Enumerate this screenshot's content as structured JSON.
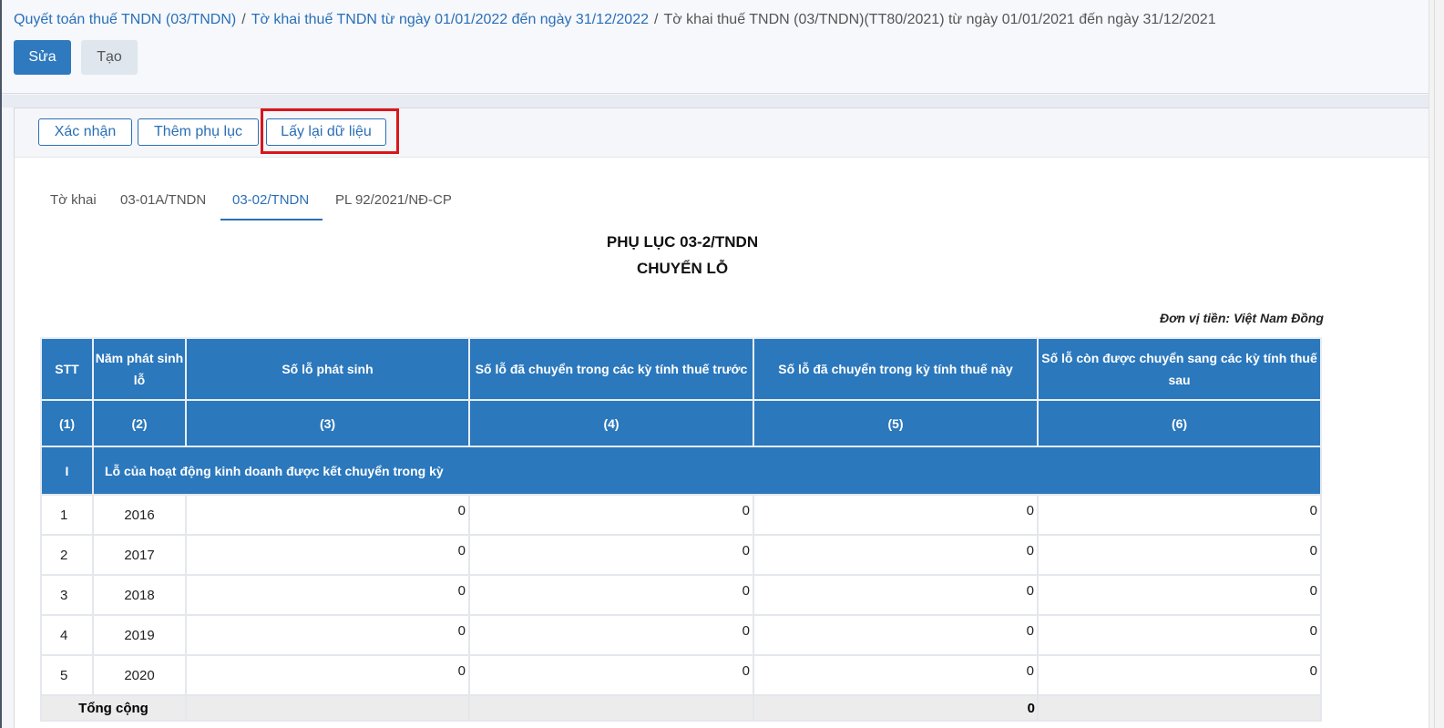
{
  "breadcrumb": {
    "item1": "Quyết toán thuế TNDN (03/TNDN)",
    "item2": "Tờ khai thuế TNDN từ ngày 01/01/2022 đến ngày 31/12/2022",
    "current": "Tờ khai thuế TNDN (03/TNDN)(TT80/2021) từ ngày 01/01/2021 đến ngày 31/12/2021",
    "separator": "/"
  },
  "header_actions": {
    "edit": "Sửa",
    "create": "Tạo"
  },
  "toolbar": {
    "confirm": "Xác nhận",
    "add_appendix": "Thêm phụ lục",
    "reload_data": "Lấy lại dữ liệu"
  },
  "tabs": [
    "Tờ khai",
    "03-01A/TNDN",
    "03-02/TNDN",
    "PL 92/2021/NĐ-CP"
  ],
  "active_tab": "03-02/TNDN",
  "document": {
    "title": "PHỤ LỤC 03-2/TNDN",
    "subtitle": "CHUYỂN LỖ",
    "unit": "Đơn vị tiền: Việt Nam Đồng"
  },
  "table": {
    "headers": [
      "STT",
      "Năm phát sinh lỗ",
      "Số lỗ phát sinh",
      "Số lỗ đã chuyển trong các kỳ tính thuế trước",
      "Số lỗ đã chuyển trong kỳ tính thuế này",
      "Số lỗ còn được chuyển sang các kỳ tính thuế sau"
    ],
    "col_numbers": [
      "(1)",
      "(2)",
      "(3)",
      "(4)",
      "(5)",
      "(6)"
    ],
    "section": {
      "roman": "I",
      "title": "Lỗ của hoạt động kinh doanh được kết chuyển trong kỳ"
    },
    "rows": [
      {
        "stt": "1",
        "year": "2016",
        "c3": "0",
        "c4": "0",
        "c5": "0",
        "c6": "0"
      },
      {
        "stt": "2",
        "year": "2017",
        "c3": "0",
        "c4": "0",
        "c5": "0",
        "c6": "0"
      },
      {
        "stt": "3",
        "year": "2018",
        "c3": "0",
        "c4": "0",
        "c5": "0",
        "c6": "0"
      },
      {
        "stt": "4",
        "year": "2019",
        "c3": "0",
        "c4": "0",
        "c5": "0",
        "c6": "0"
      },
      {
        "stt": "5",
        "year": "2020",
        "c3": "0",
        "c4": "0",
        "c5": "0",
        "c6": "0"
      }
    ],
    "total": {
      "label": "Tổng cộng",
      "c5": "0"
    }
  },
  "colors": {
    "primary": "#2f79bf",
    "table_header": "#2b78bd",
    "highlight": "#d9161b"
  }
}
